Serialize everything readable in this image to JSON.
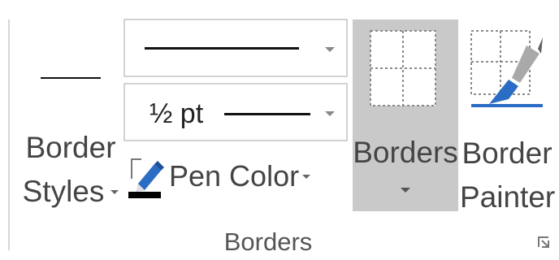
{
  "group": {
    "label": "Borders"
  },
  "border_styles": {
    "label_line1": "Border",
    "label_line2": "Styles"
  },
  "pen_style": {
    "selected_style": "solid line"
  },
  "pen_weight": {
    "value": "½ pt"
  },
  "pen_color": {
    "label": "Pen Color",
    "color": "#000000",
    "pen_icon_color": "#2b6cc4"
  },
  "borders_button": {
    "label": "Borders",
    "state": "pressed",
    "highlight_color": "#c9c9c9"
  },
  "border_painter": {
    "label_line1": "Border",
    "label_line2": "Painter"
  },
  "icons": {
    "pen_color": "pen-icon",
    "borders": "table-grid-icon",
    "border_painter": "paintbrush-icon",
    "group_launcher": "dialog-launcher-icon",
    "dropdown": "chevron-down-icon"
  }
}
